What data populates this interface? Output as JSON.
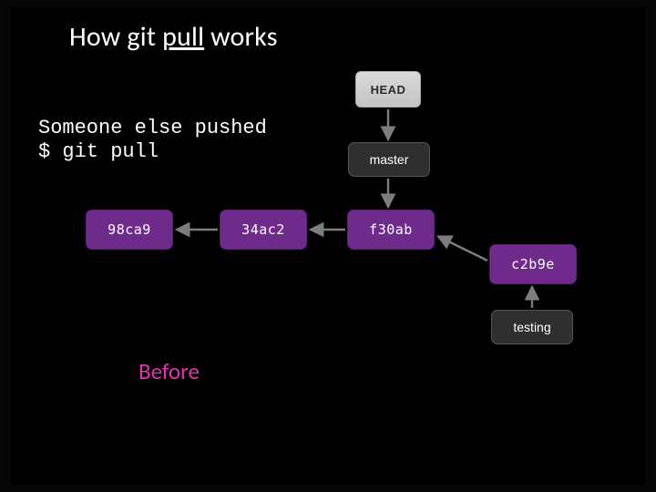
{
  "title": {
    "pre": "How git ",
    "ul": "pull",
    "post": " works"
  },
  "code": {
    "line1": "Someone else pushed",
    "prompt": "$",
    "cmd": "git pull"
  },
  "nodes": {
    "head": "HEAD",
    "master": "master",
    "testing": "testing",
    "c1": "98ca9",
    "c2": "34ac2",
    "c3": "f30ab",
    "c4": "c2b9e"
  },
  "label": {
    "before": "Before"
  },
  "chart_data": {
    "type": "diagram",
    "title": "How git pull works",
    "subtitle": "Before",
    "annotations": [
      "Someone else pushed",
      "$ git pull"
    ],
    "nodes": [
      {
        "id": "HEAD",
        "kind": "head"
      },
      {
        "id": "master",
        "kind": "branch"
      },
      {
        "id": "testing",
        "kind": "branch"
      },
      {
        "id": "98ca9",
        "kind": "commit"
      },
      {
        "id": "34ac2",
        "kind": "commit"
      },
      {
        "id": "f30ab",
        "kind": "commit"
      },
      {
        "id": "c2b9e",
        "kind": "commit"
      }
    ],
    "edges": [
      {
        "from": "HEAD",
        "to": "master"
      },
      {
        "from": "master",
        "to": "f30ab"
      },
      {
        "from": "34ac2",
        "to": "98ca9"
      },
      {
        "from": "f30ab",
        "to": "34ac2"
      },
      {
        "from": "c2b9e",
        "to": "f30ab"
      },
      {
        "from": "testing",
        "to": "c2b9e"
      }
    ]
  }
}
